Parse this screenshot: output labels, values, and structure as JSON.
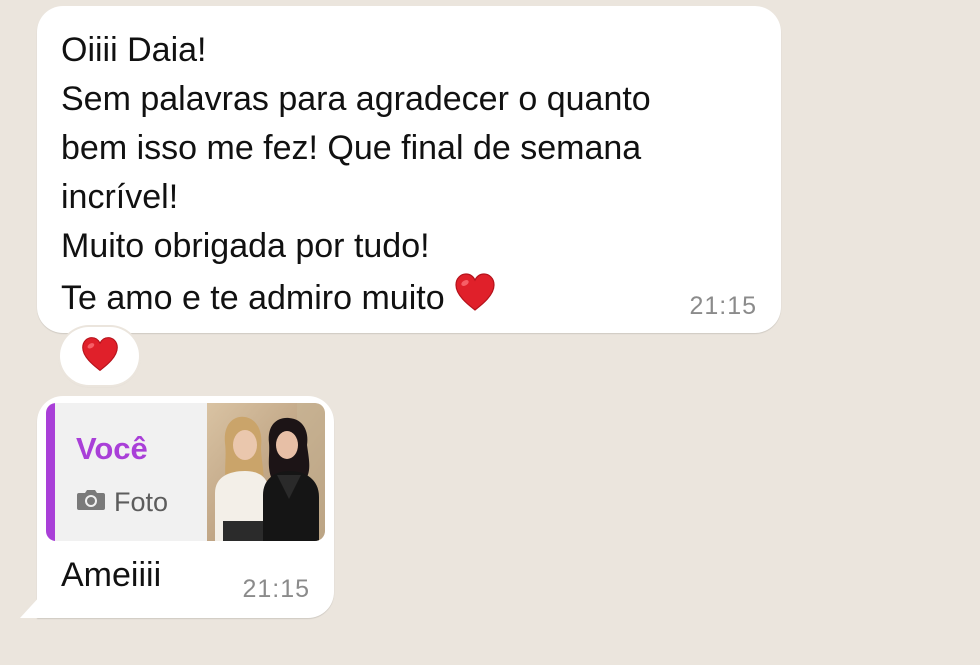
{
  "message_received": {
    "lines": [
      "Oiiii Daia!",
      "Sem palavras para agradecer o quanto",
      "bem isso me fez! Que final de semana",
      "incrível!",
      "Muito obrigada por tudo!",
      "Te amo e te admiro muito"
    ],
    "trailing_emoji": "heart-icon",
    "time": "21:15",
    "reaction": "heart-icon"
  },
  "message_reply": {
    "quoted": {
      "author": "Você",
      "type_label": "Foto",
      "type_icon": "camera-icon",
      "accent_color": "#a93fd8"
    },
    "text": "Ameiiii",
    "time": "21:15"
  },
  "colors": {
    "background": "#ebe5dd",
    "bubble": "#ffffff",
    "heart": "#e0202a"
  }
}
